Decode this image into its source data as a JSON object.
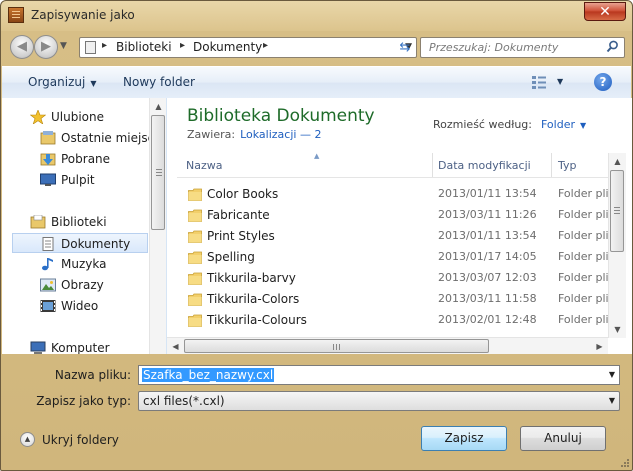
{
  "window": {
    "title": "Zapisywanie jako",
    "close_glyph": "✕"
  },
  "address": {
    "crumbs": [
      "Biblioteki",
      "Dokumenty"
    ],
    "search_placeholder": "Przeszukaj: Dokumenty"
  },
  "toolbar": {
    "organize_label": "Organizuj",
    "new_folder_label": "Nowy folder",
    "help_glyph": "?"
  },
  "nav": {
    "favorites_label": "Ulubione",
    "favorites": [
      "Ostatnie miejsca",
      "Pobrane",
      "Pulpit"
    ],
    "libraries_label": "Biblioteki",
    "libraries": [
      "Dokumenty",
      "Muzyka",
      "Obrazy",
      "Wideo"
    ],
    "computer_label": "Komputer",
    "selected": "Dokumenty"
  },
  "library": {
    "title": "Biblioteka Dokumenty",
    "contains_label": "Zawiera:",
    "locations_link": "Lokalizacji — 2",
    "arrange_label": "Rozmieść według:",
    "arrange_value": "Folder"
  },
  "columns": {
    "name": "Nazwa",
    "date": "Data modyfikacji",
    "type": "Typ"
  },
  "files": [
    {
      "name": "Color Books",
      "date": "2013/01/11 13:54",
      "type": "Folder pli"
    },
    {
      "name": "Fabricante",
      "date": "2013/03/11 11:26",
      "type": "Folder pli"
    },
    {
      "name": "Print Styles",
      "date": "2013/01/11 13:54",
      "type": "Folder pli"
    },
    {
      "name": "Spelling",
      "date": "2013/01/17 14:05",
      "type": "Folder pli"
    },
    {
      "name": "Tikkurila-barvy",
      "date": "2013/03/07 12:03",
      "type": "Folder pli"
    },
    {
      "name": "Tikkurila-Colors",
      "date": "2013/03/11 11:58",
      "type": "Folder pli"
    },
    {
      "name": "Tikkurila-Colours",
      "date": "2013/02/01 12:48",
      "type": "Folder pli"
    }
  ],
  "form": {
    "filename_label": "Nazwa pliku:",
    "filename_value": "Szafka_bez_nazwy.cxl",
    "type_label": "Zapisz jako typ:",
    "type_value": "cxl files(*.cxl)"
  },
  "footer": {
    "hide_folders_label": "Ukryj foldery",
    "save_label": "Zapisz",
    "cancel_label": "Anuluj"
  },
  "colors": {
    "frame": "#d7be86",
    "library_title": "#1e6b29",
    "link": "#1f5fbf",
    "selection": "#3399ff"
  }
}
